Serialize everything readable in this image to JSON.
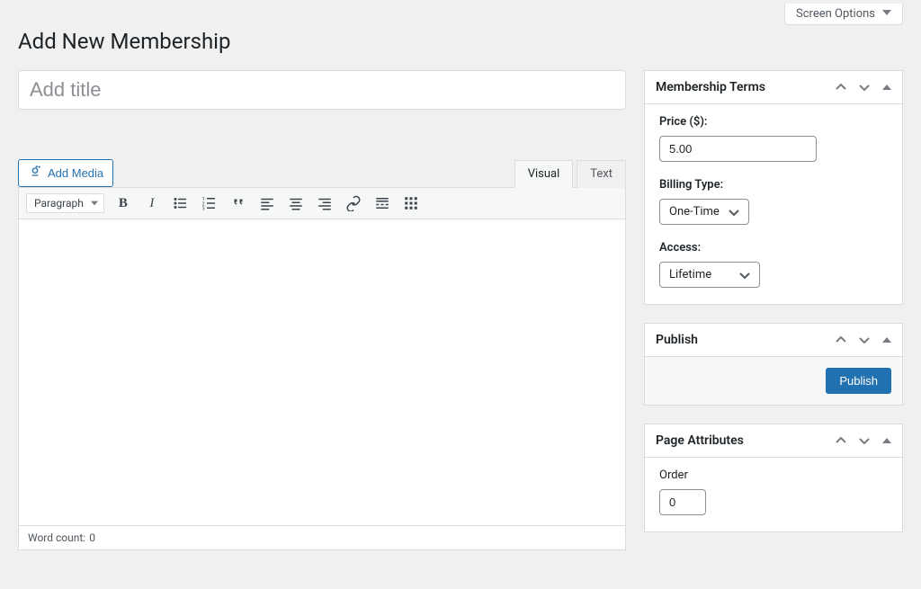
{
  "screen_options_label": "Screen Options",
  "page_title": "Add New Membership",
  "title_placeholder": "Add title",
  "title_value": "",
  "add_media_label": "Add Media",
  "editor": {
    "tabs": {
      "visual": "Visual",
      "text": "Text"
    },
    "format_selected": "Paragraph",
    "word_count_label": "Word count:",
    "word_count_value": "0",
    "content": ""
  },
  "membership_terms": {
    "box_title": "Membership Terms",
    "price_label": "Price ($):",
    "price_value": "5.00",
    "billing_label": "Billing Type:",
    "billing_selected": "One-Time",
    "access_label": "Access:",
    "access_selected": "Lifetime"
  },
  "publish": {
    "box_title": "Publish",
    "button_label": "Publish"
  },
  "page_attributes": {
    "box_title": "Page Attributes",
    "order_label": "Order",
    "order_value": "0"
  }
}
